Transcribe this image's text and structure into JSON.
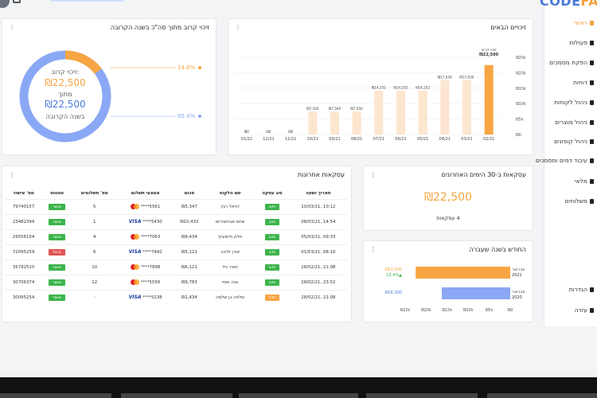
{
  "sidebar": {
    "logo_a": "CODE",
    "logo_b": "FA",
    "items": [
      {
        "label": "ראשי",
        "active": true
      },
      {
        "label": "פעולות"
      },
      {
        "label": "הפקת מסמכים"
      },
      {
        "label": "דוחות"
      },
      {
        "label": "ניהול לקוחות"
      },
      {
        "label": "ניהול מוצרים"
      },
      {
        "label": "ניהול קופונים"
      },
      {
        "label": "עיבוד דמים ומסמכים"
      },
      {
        "label": "מלאי"
      },
      {
        "label": "משלוחים"
      },
      {
        "label": "הגדרות"
      },
      {
        "label": "עזרה"
      }
    ]
  },
  "donut_card": {
    "title": "זיכוי קרוב מתוך סה\"כ בשנה הקרובה",
    "center_label1": "זיכוי קרוב:",
    "center_value1": "₪22,500",
    "center_mid": "מתוך",
    "center_value2": "₪22,500",
    "center_label2": "בשנה הקרובה",
    "pct_orange": "14.6%",
    "pct_blue": "85.4%",
    "orange_fraction": 0.146,
    "colors": {
      "orange": "#f7a542",
      "blue": "#8aa8f5"
    }
  },
  "bar_card": {
    "title": "זיכויים הבאים",
    "highlight_label": "זיכוי קרוב",
    "highlight_value": "₪22,500"
  },
  "chart_data": {
    "type": "bar",
    "categories": [
      "01/22",
      "12/21",
      "11/21",
      "10/21",
      "09/21",
      "08/21",
      "07/21",
      "06/21",
      "05/21",
      "04/21",
      "03/21",
      "02/21"
    ],
    "values": [
      0,
      0,
      0,
      7500,
      7500,
      7500,
      14252,
      14252,
      14252,
      17630,
      17630,
      22500
    ],
    "value_labels": [
      "₪0",
      "₪0",
      "₪0",
      "₪7,500",
      "₪7,500",
      "₪7,500",
      "₪14,252",
      "₪14,252",
      "₪14,252",
      "₪17,630",
      "₪17,630",
      "₪22,500"
    ],
    "ylim": [
      0,
      25000
    ],
    "yticks": [
      0,
      5000,
      10000,
      15000,
      20000,
      25000
    ],
    "ytick_labels": [
      "₪0",
      "₪5k",
      "₪10k",
      "₪15k",
      "₪20k",
      "₪25k"
    ],
    "colors": {
      "normal": "#fde6cf",
      "highlight": "#f7a542"
    },
    "grid": true
  },
  "recent_card": {
    "title": "עסקאות ב-30 הימים האחרונים",
    "value": "₪22,500",
    "count": "4 עסקאות"
  },
  "compare_card": {
    "title": "החודש בשנה שעברה",
    "rows": [
      {
        "label": "פברואר 2021",
        "value": "₪22,500",
        "change": "15.4%▲",
        "amount": 22500,
        "color": "#f7a542"
      },
      {
        "label": "פברואר 2020",
        "value": "₪16,300",
        "amount": 16300,
        "color": "#8aa8f5"
      }
    ],
    "max": 25000,
    "ticks": [
      "₪25k",
      "₪20k",
      "₪15k",
      "₪10k",
      "₪5k",
      "₪0"
    ]
  },
  "table": {
    "title": "עסקאות אחרונות",
    "headers": [
      "תאריך ושעה",
      "סוג עסקה",
      "שם הלקוח",
      "סכום",
      "אמצעי תשלום",
      "מס' תשלומים",
      "סטטוס",
      "מס' אישור"
    ],
    "rows": [
      {
        "date": "10/03/21, 10:12",
        "type": "חיוב",
        "type_color": "#3cb44b",
        "name": "דניאל רבין",
        "sum": "₪5,347",
        "card": "mc",
        "num": "****5561",
        "payments": "5",
        "status": "אושר",
        "status_color": "#3cb44b",
        "auth": "79740157"
      },
      {
        "date": "08/03/21, 14:54",
        "type": "חיוב",
        "type_color": "#3cb44b",
        "name": "שחם אבוחציראו",
        "sum": "₪10,432",
        "card": "visa",
        "num": "****5430",
        "payments": "1",
        "status": "אושר",
        "status_color": "#3cb44b",
        "auth": "23482394"
      },
      {
        "date": "05/03/21, 09:33",
        "type": "חיוב",
        "type_color": "#3cb44b",
        "name": "חלק חיימוביץ",
        "sum": "₪9,434",
        "card": "mc",
        "num": "****7063",
        "payments": "4",
        "status": "אושר",
        "status_color": "#3cb44b",
        "auth": "29556154"
      },
      {
        "date": "01/03/21, 08:10",
        "type": "חיוב",
        "type_color": "#3cb44b",
        "name": "אורן זליכה",
        "sum": "₪5,121",
        "card": "visa",
        "num": "****7492",
        "payments": "6",
        "status": "נכשל",
        "status_color": "#e05252",
        "auth": "72095259"
      },
      {
        "date": "28/02/21, 21:08",
        "type": "חיוב",
        "type_color": "#3cb44b",
        "name": "חאיר ניל",
        "sum": "₪6,121",
        "card": "mc",
        "num": "****7898",
        "payments": "10",
        "status": "אושר",
        "status_color": "#3cb44b",
        "auth": "35792510"
      },
      {
        "date": "28/02/21, 23:52",
        "type": "חיוב",
        "type_color": "#3cb44b",
        "name": "נונה אפוי",
        "sum": "₪9,783",
        "card": "mc",
        "num": "****5556",
        "payments": "12",
        "status": "אושר",
        "status_color": "#3cb44b",
        "auth": "30706374"
      },
      {
        "date": "28/02/21, 21:08",
        "type": "זיכוי",
        "type_color": "#f7a542",
        "name": "שלחה בן שלמה",
        "sum": "₪1,434",
        "card": "visa",
        "num": "****5238",
        "payments": "-",
        "status": "אושר",
        "status_color": "#3cb44b",
        "auth": "30095254"
      }
    ]
  }
}
